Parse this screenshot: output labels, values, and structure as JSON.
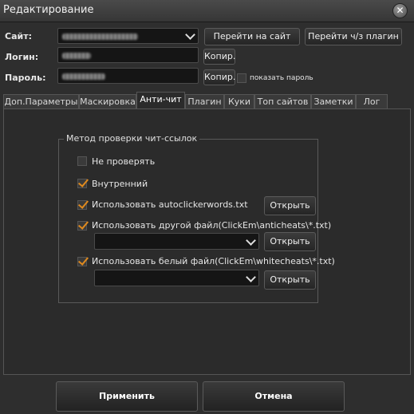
{
  "window": {
    "title": "Редактирование"
  },
  "form": {
    "site_label": "Сайт:",
    "login_label": "Логин:",
    "password_label": "Пароль:",
    "goto_site_button": "Перейти на сайт",
    "goto_via_plugin_button": "Перейти ч/з плагин",
    "copy_login_button": "Копир.",
    "copy_password_button": "Копир.",
    "show_password_label": "показать пароль"
  },
  "tabs": [
    {
      "label": "Доп.Параметры"
    },
    {
      "label": "Маскировка"
    },
    {
      "label": "Анти-чит"
    },
    {
      "label": "Плагин"
    },
    {
      "label": "Куки"
    },
    {
      "label": "Топ сайтов"
    },
    {
      "label": "Заметки"
    },
    {
      "label": "Лог"
    }
  ],
  "anticheat": {
    "group_title": "Метод проверки чит-ссылок",
    "options": [
      {
        "label": "Не проверять",
        "checked": false
      },
      {
        "label": "Внутренний",
        "checked": true
      },
      {
        "label": "Использовать autoclickerwords.txt",
        "checked": true
      },
      {
        "label": "Использовать другой файл(ClickEm\\anticheats\\*.txt)",
        "checked": true
      },
      {
        "label": "Использовать белый файл(ClickEm\\whitecheats\\*.txt)",
        "checked": true
      }
    ],
    "open_button": "Открыть"
  },
  "footer": {
    "apply_button": "Применить",
    "cancel_button": "Отмена"
  }
}
